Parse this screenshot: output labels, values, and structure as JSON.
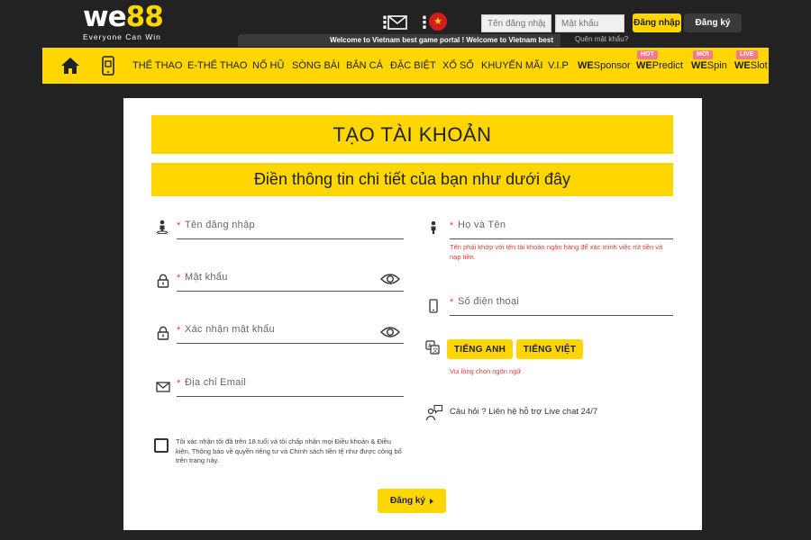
{
  "brand": {
    "logo_we": "we",
    "logo_88": "88",
    "tagline": "Everyone Can Win"
  },
  "header": {
    "username_placeholder": "Tên đăng nhập",
    "password_placeholder": "Mật khẩu",
    "login_label": "Đăng nhập",
    "register_label": "Đăng ký",
    "marquee_text": "Welcome to Vietnam best game portal ! Welcome to Vietnam best",
    "forgot_password": "Quên mật khẩu?"
  },
  "nav": {
    "items": [
      {
        "label": "THỂ THAO"
      },
      {
        "label": "E-THỂ THAO"
      },
      {
        "label": "NỔ HŨ"
      },
      {
        "label": "SÒNG BÀI"
      },
      {
        "label": "BẮN CÁ"
      },
      {
        "label": "ĐẶC BIỆT"
      },
      {
        "label": "XỔ SỐ"
      },
      {
        "label": "KHUYẾN MÃI"
      },
      {
        "label": "V.I.P"
      }
    ],
    "brand_items": [
      {
        "prefix": "WE",
        "suffix": "Sponsor",
        "badge": ""
      },
      {
        "prefix": "WE",
        "suffix": "Predict",
        "badge": "HOT"
      },
      {
        "prefix": "WE",
        "suffix": "Spin",
        "badge": "MỚI"
      },
      {
        "prefix": "WE",
        "suffix": "Slot",
        "badge": "LIVE"
      }
    ]
  },
  "form": {
    "title": "TẠO TÀI KHOẢN",
    "subtitle": "Điền thông tin chi tiết của bạn như dưới đây",
    "required_mark": "*",
    "fields": {
      "username": "Tên đăng nhập",
      "password": "Mật khẩu",
      "confirm_password": "Xác nhận mật khẩu",
      "email": "Địa chỉ Email",
      "fullname": "Họ và Tên",
      "phone": "Số điện thoại"
    },
    "fullname_hint": "Tên phải khớp với tên tài khoản ngân hàng để xác minh việc rút tiền và nạp tiền.",
    "languages": [
      "TIẾNG ANH",
      "TIẾNG VIỆT"
    ],
    "language_hint": "Vui lòng chọn ngôn ngữ",
    "support_text": "Câu hỏi ? Liên hệ hỗ trợ Live chat 24/7",
    "terms_text": "Tôi xác nhận tôi đã trên 18 tuổi và tôi chấp nhận mọi Điều khoản & Điều kiện, Thông báo về quyền riêng tư và Chính sách tiền tệ như được công bố trên trang này.",
    "submit_label": "Đăng ký"
  },
  "colors": {
    "accent": "#ffd600",
    "background": "#222222",
    "error": "#e53935"
  }
}
